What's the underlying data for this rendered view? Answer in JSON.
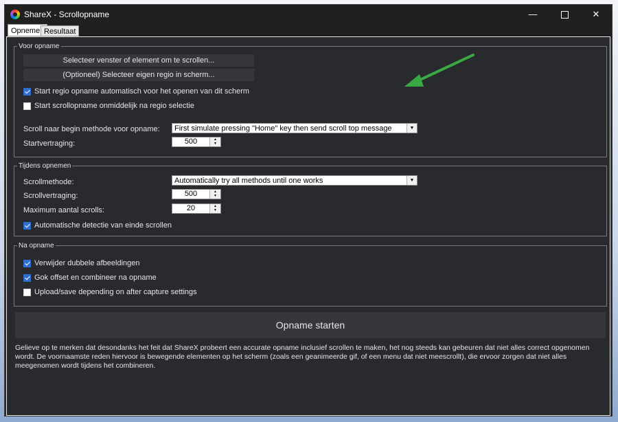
{
  "window": {
    "title": "ShareX - Scrollopname",
    "controls": {
      "minimize": "—",
      "close": "✕"
    }
  },
  "tabs": [
    {
      "label": "Opnemen",
      "active": true
    },
    {
      "label": "Resultaat",
      "active": false
    }
  ],
  "before": {
    "legend": "Voor opname",
    "select_window_button": "Selecteer venster of element om te scrollen...",
    "select_region_button": "(Optioneel) Selecteer eigen regio in scherm...",
    "auto_region_checkbox": {
      "label": "Start regio opname automatisch voor het openen van dit scherm",
      "checked": true
    },
    "start_immediately_checkbox": {
      "label": "Start scrollopname onmiddelijk na regio selectie",
      "checked": false
    },
    "scroll_method_label": "Scroll naar begin methode voor opname:",
    "scroll_method_value": "First simulate pressing \"Home\" key then send scroll top message",
    "start_delay_label": "Startvertraging:",
    "start_delay_value": "500"
  },
  "during": {
    "legend": "Tijdens opnemen",
    "scroll_method_label": "Scrollmethode:",
    "scroll_method_value": "Automatically try all methods until one works",
    "scroll_delay_label": "Scrollvertraging:",
    "scroll_delay_value": "500",
    "max_scrolls_label": "Maximum aantal scrolls:",
    "max_scrolls_value": "20",
    "auto_detect_checkbox": {
      "label": "Automatische detectie van einde scrollen",
      "checked": true
    }
  },
  "after": {
    "legend": "Na opname",
    "remove_duplicates_checkbox": {
      "label": "Verwijder dubbele afbeeldingen",
      "checked": true
    },
    "guess_offset_checkbox": {
      "label": "Gok offset en combineer na opname",
      "checked": true
    },
    "upload_checkbox": {
      "label": "Upload/save depending on after capture settings",
      "checked": false
    }
  },
  "start_button": "Opname starten",
  "note": "Gelieve op te merken dat desondanks het feit dat ShareX probeert een accurate opname inclusief scrollen te maken, het nog steeds kan gebeuren dat niet alles correct opgenomen wordt. De voornaamste reden hiervoor is bewegende elementen op het scherm (zoals een geanimeerde gif, of een menu dat niet meescrollt), die ervoor zorgen dat niet alles meegenomen wordt tijdens het combineren.",
  "annotation": {
    "arrow_color": "#3aa845"
  }
}
